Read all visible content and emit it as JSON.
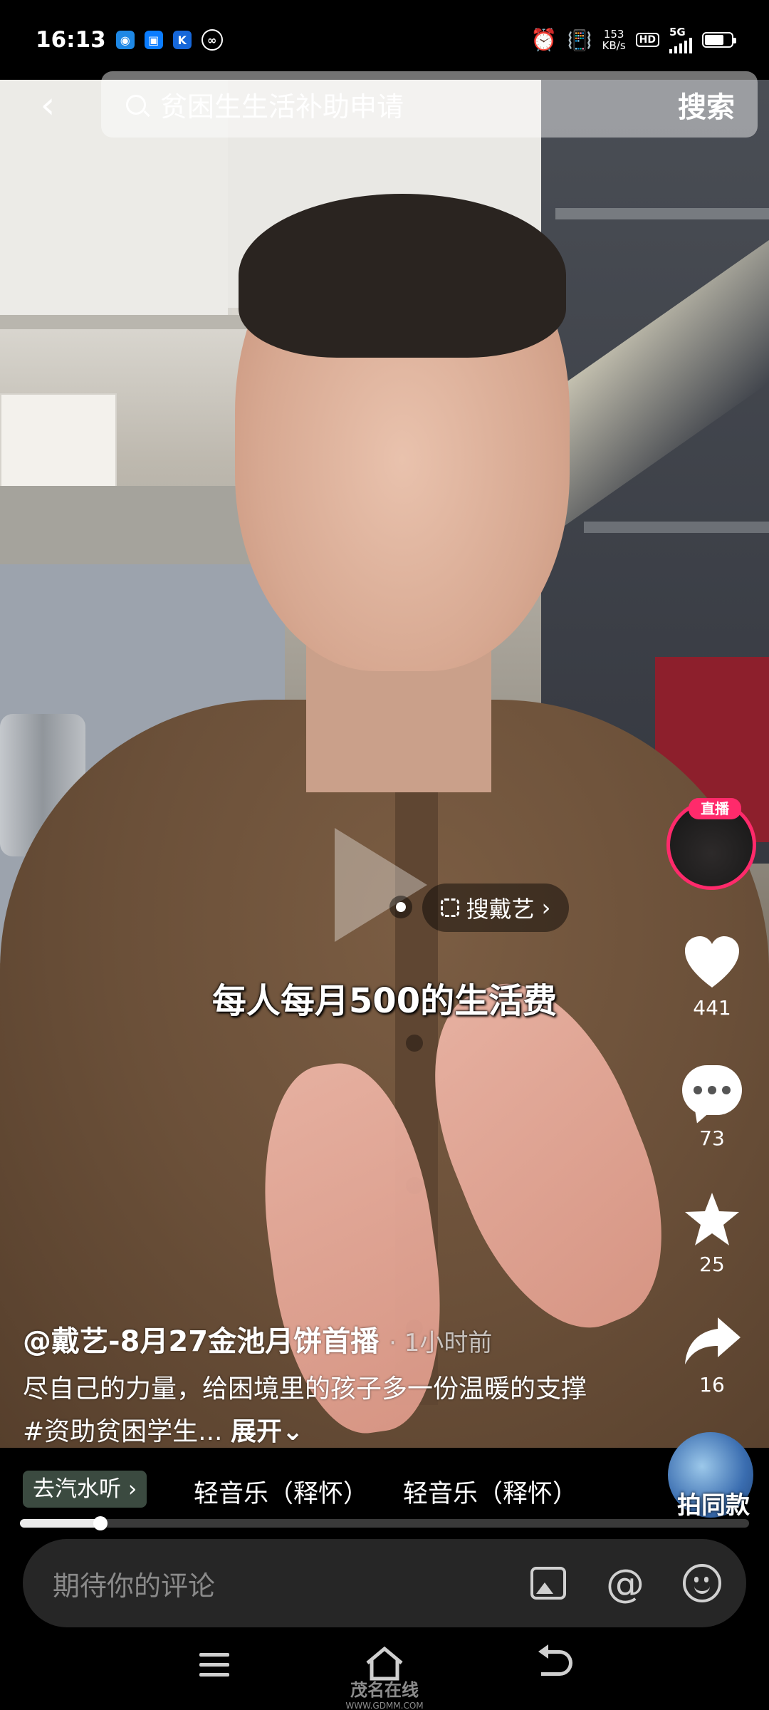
{
  "status_bar": {
    "time": "16:13",
    "app_icons": [
      "wifi-calling-icon",
      "security-icon",
      "k-app-icon",
      "link-icon"
    ],
    "net_speed_value": "153",
    "net_speed_unit": "KB/s",
    "hd_label": "HD",
    "network_label": "5G"
  },
  "search": {
    "query": "贫困生生活补助申请",
    "search_button": "搜索"
  },
  "video": {
    "search_chip": "搜戴艺",
    "subtitle": "每人每月500的生活费",
    "live_badge": "直播",
    "accent_color": "#ff2a6b"
  },
  "actions": {
    "likes": "441",
    "comments": "73",
    "favorites": "25",
    "shares": "16"
  },
  "post": {
    "author": "@戴艺-8月27金池月饼首播",
    "time_ago": "· 1小时前",
    "description": "尽自己的力量，给困境里的孩子多一份温暖的支撑 #资助贫困学生...",
    "expand_label": "展开"
  },
  "music": {
    "listen_label": "去汽水听",
    "track_1": "轻音乐（释怀）",
    "track_2": "轻音乐（释怀）",
    "same_style_label": "拍同款",
    "progress_fraction": 0.11
  },
  "comment_bar": {
    "placeholder": "期待你的评论",
    "mention_symbol": "@"
  },
  "watermark": {
    "brand": "茂名在线",
    "url": "WWW.GDMM.COM"
  }
}
